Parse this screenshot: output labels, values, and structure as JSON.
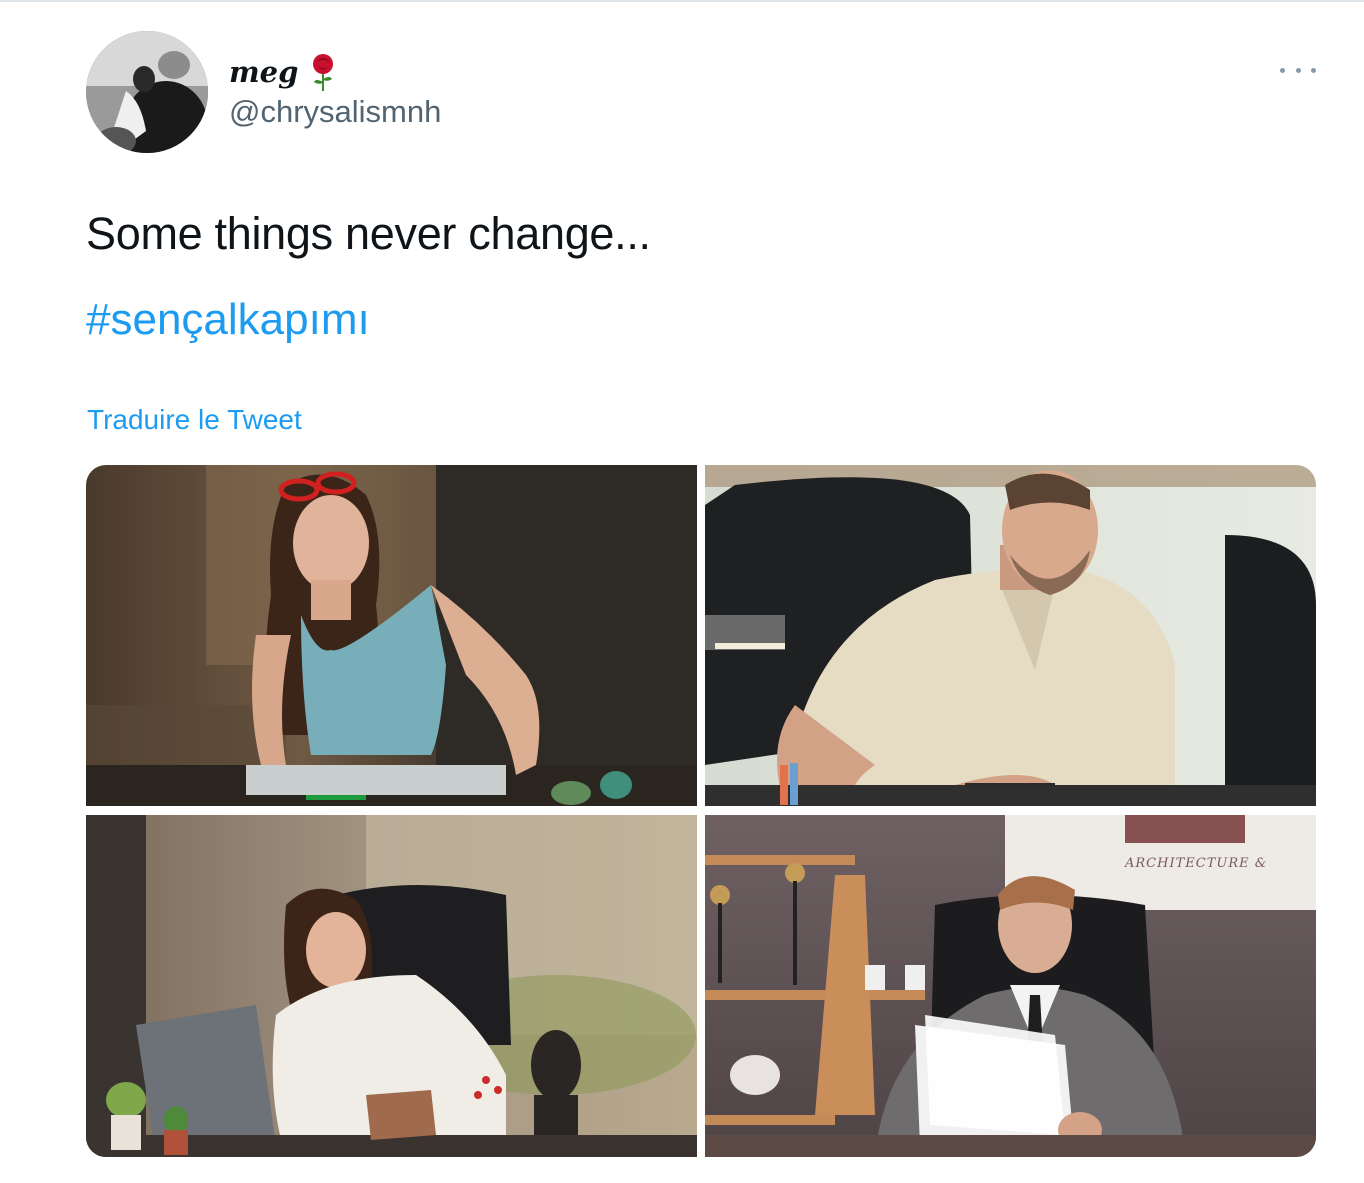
{
  "author": {
    "display_name": "meg",
    "emoji_icon": "rose-icon",
    "handle": "@chrysalismnh"
  },
  "tweet": {
    "text": "Some things never change...",
    "hashtag": "#sençalkapımı",
    "translate_label": "Traduire le Tweet"
  },
  "media": {
    "photos": [
      {
        "name": "photo-woman-drawing-at-desk",
        "sign_text": ""
      },
      {
        "name": "photo-man-smiling-at-desk",
        "sign_text": ""
      },
      {
        "name": "photo-woman-writing-at-desk",
        "sign_text": ""
      },
      {
        "name": "photo-man-in-suit-reading",
        "sign_text": "ARCHITECTURE &"
      }
    ]
  },
  "colors": {
    "link": "#1d9bf0",
    "text": "#0f1419",
    "secondary": "#536471"
  }
}
